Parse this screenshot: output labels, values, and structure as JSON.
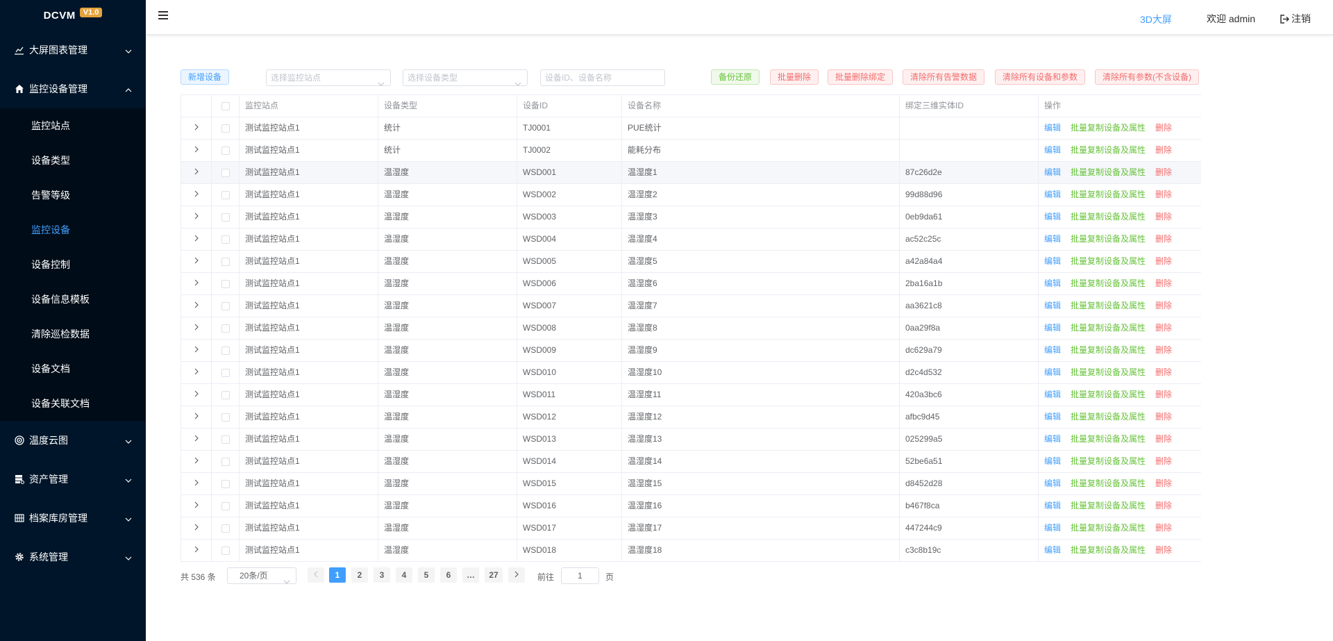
{
  "brand": {
    "name": "DCVM",
    "version": "V1.0"
  },
  "sidebar": {
    "groups": [
      {
        "label": "大屏图表管理",
        "icon": "chart-line-icon",
        "expanded": false
      },
      {
        "label": "监控设备管理",
        "icon": "home-icon",
        "expanded": true,
        "items": [
          "监控站点",
          "设备类型",
          "告警等级",
          "监控设备",
          "设备控制",
          "设备信息模板",
          "清除巡检数据",
          "设备文档",
          "设备关联文档"
        ],
        "active_item": "监控设备"
      },
      {
        "label": "温度云图",
        "icon": "target-icon",
        "expanded": false
      },
      {
        "label": "资产管理",
        "icon": "server-icon",
        "expanded": false
      },
      {
        "label": "档案库房管理",
        "icon": "grid-icon",
        "expanded": false
      },
      {
        "label": "系统管理",
        "icon": "gear-icon",
        "expanded": false
      }
    ]
  },
  "header": {
    "screen3d": "3D大屏",
    "welcome": "欢迎 admin",
    "logout": "注销"
  },
  "toolbar": {
    "add_device": "新增设备",
    "site_placeholder": "选择监控站点",
    "type_placeholder": "选择设备类型",
    "search_placeholder": "设备ID、设备名称",
    "backup_restore": "备份还原",
    "batch_delete": "批量删除",
    "batch_unbind": "批量删除绑定",
    "clear_alarms": "清除所有告警数据",
    "clear_devices_params": "清除所有设备和参数",
    "clear_params": "清除所有参数(不含设备)"
  },
  "table": {
    "headers": {
      "site": "监控站点",
      "type": "设备类型",
      "id": "设备ID",
      "name": "设备名称",
      "entity3d": "绑定三维实体ID",
      "ops": "操作"
    },
    "op_labels": {
      "edit": "编辑",
      "copy": "批量复制设备及属性",
      "delete": "删除"
    },
    "rows": [
      {
        "site": "测试监控站点1",
        "type": "统计",
        "id": "TJ0001",
        "name": "PUE统计",
        "entity3d": ""
      },
      {
        "site": "测试监控站点1",
        "type": "统计",
        "id": "TJ0002",
        "name": "能耗分布",
        "entity3d": ""
      },
      {
        "site": "测试监控站点1",
        "type": "温湿度",
        "id": "WSD001",
        "name": "温湿度1",
        "entity3d": "87c26d2e"
      },
      {
        "site": "测试监控站点1",
        "type": "温湿度",
        "id": "WSD002",
        "name": "温湿度2",
        "entity3d": "99d88d96"
      },
      {
        "site": "测试监控站点1",
        "type": "温湿度",
        "id": "WSD003",
        "name": "温湿度3",
        "entity3d": "0eb9da61"
      },
      {
        "site": "测试监控站点1",
        "type": "温湿度",
        "id": "WSD004",
        "name": "温湿度4",
        "entity3d": "ac52c25c"
      },
      {
        "site": "测试监控站点1",
        "type": "温湿度",
        "id": "WSD005",
        "name": "温湿度5",
        "entity3d": "a42a84a4"
      },
      {
        "site": "测试监控站点1",
        "type": "温湿度",
        "id": "WSD006",
        "name": "温湿度6",
        "entity3d": "2ba16a1b"
      },
      {
        "site": "测试监控站点1",
        "type": "温湿度",
        "id": "WSD007",
        "name": "温湿度7",
        "entity3d": "aa3621c8"
      },
      {
        "site": "测试监控站点1",
        "type": "温湿度",
        "id": "WSD008",
        "name": "温湿度8",
        "entity3d": "0aa29f8a"
      },
      {
        "site": "测试监控站点1",
        "type": "温湿度",
        "id": "WSD009",
        "name": "温湿度9",
        "entity3d": "dc629a79"
      },
      {
        "site": "测试监控站点1",
        "type": "温湿度",
        "id": "WSD010",
        "name": "温湿度10",
        "entity3d": "d2c4d532"
      },
      {
        "site": "测试监控站点1",
        "type": "温湿度",
        "id": "WSD011",
        "name": "温湿度11",
        "entity3d": "420a3bc6"
      },
      {
        "site": "测试监控站点1",
        "type": "温湿度",
        "id": "WSD012",
        "name": "温湿度12",
        "entity3d": "afbc9d45"
      },
      {
        "site": "测试监控站点1",
        "type": "温湿度",
        "id": "WSD013",
        "name": "温湿度13",
        "entity3d": "025299a5"
      },
      {
        "site": "测试监控站点1",
        "type": "温湿度",
        "id": "WSD014",
        "name": "温湿度14",
        "entity3d": "52be6a51"
      },
      {
        "site": "测试监控站点1",
        "type": "温湿度",
        "id": "WSD015",
        "name": "温湿度15",
        "entity3d": "d8452d28"
      },
      {
        "site": "测试监控站点1",
        "type": "温湿度",
        "id": "WSD016",
        "name": "温湿度16",
        "entity3d": "b467f8ca"
      },
      {
        "site": "测试监控站点1",
        "type": "温湿度",
        "id": "WSD017",
        "name": "温湿度17",
        "entity3d": "447244c9"
      },
      {
        "site": "测试监控站点1",
        "type": "温湿度",
        "id": "WSD018",
        "name": "温湿度18",
        "entity3d": "c3c8b19c"
      }
    ],
    "hover_row": 2
  },
  "pagination": {
    "total": "共 536 条",
    "page_size": "20条/页",
    "pages": [
      "1",
      "2",
      "3",
      "4",
      "5",
      "6",
      "…",
      "27"
    ],
    "current": "1",
    "goto_label": "前往",
    "goto_value": "1",
    "page_suffix": "页"
  },
  "colors": {
    "sidebar_bg": "#001529",
    "submenu_bg": "#000c17",
    "accent": "#409eff",
    "success": "#67c23a",
    "danger": "#f56c6c",
    "badge": "#e6a23c"
  }
}
